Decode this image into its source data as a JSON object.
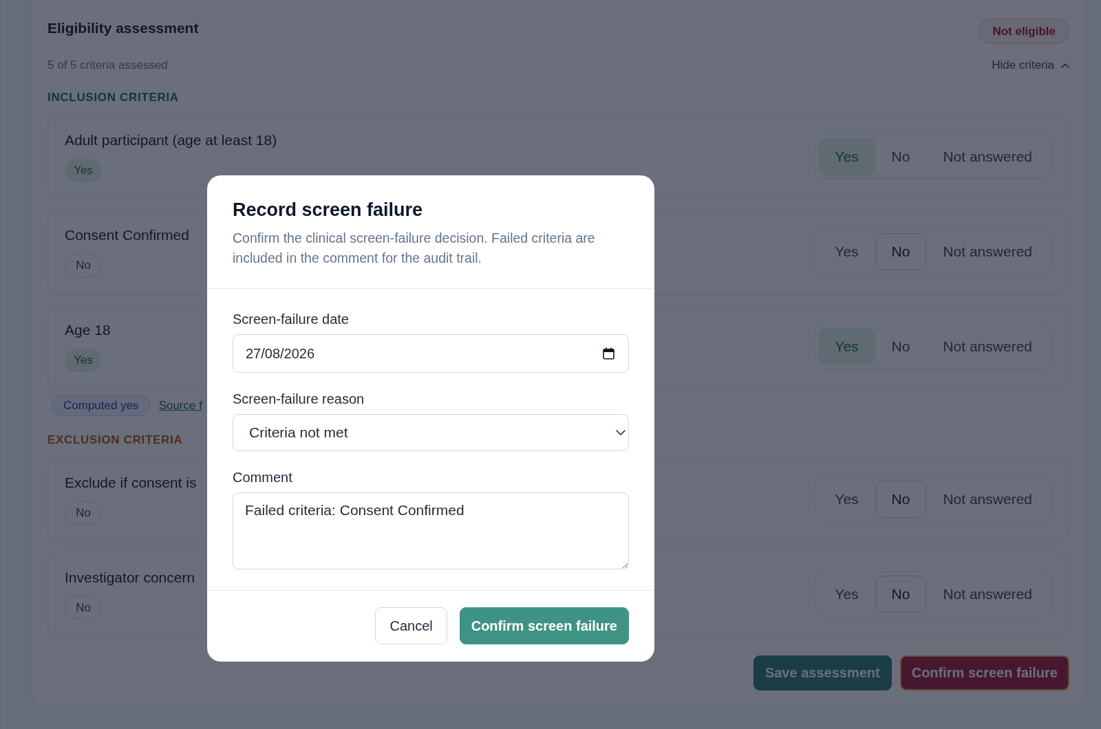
{
  "assessment": {
    "title": "Eligibility assessment",
    "status_badge": "Not eligible",
    "progress": "5 of 5 criteria assessed",
    "toggle": {
      "label": "Hide criteria",
      "expanded": true
    }
  },
  "sections": [
    {
      "heading": "INCLUSION CRITERIA",
      "kind": "inclusion",
      "criteria": [
        {
          "title": "Adult participant (age at least 18)",
          "answer": {
            "label": "Yes",
            "kind": "yes"
          },
          "options": [
            {
              "label": "Yes",
              "kind": "yes",
              "selected": true
            },
            {
              "label": "No",
              "kind": "no",
              "selected": false
            },
            {
              "label": "Not answered",
              "kind": "unanswered",
              "selected": false
            }
          ]
        },
        {
          "title": "Consent Confirmed",
          "answer": {
            "label": "No",
            "kind": "no"
          },
          "options": [
            {
              "label": "Yes",
              "kind": "yes",
              "selected": false
            },
            {
              "label": "No",
              "kind": "no",
              "selected": true
            },
            {
              "label": "Not answered",
              "kind": "unanswered",
              "selected": false
            }
          ]
        },
        {
          "title": "Age 18",
          "answer": {
            "label": "Yes",
            "kind": "yes"
          },
          "options": [
            {
              "label": "Yes",
              "kind": "yes",
              "selected": true
            },
            {
              "label": "No",
              "kind": "no",
              "selected": false
            },
            {
              "label": "Not answered",
              "kind": "unanswered",
              "selected": false
            }
          ],
          "computed": {
            "badge": "Computed yes",
            "link": "Source f"
          }
        }
      ]
    },
    {
      "heading": "EXCLUSION CRITERIA",
      "kind": "exclusion",
      "criteria": [
        {
          "title": "Exclude if consent is",
          "answer": {
            "label": "No",
            "kind": "no"
          },
          "options": [
            {
              "label": "Yes",
              "kind": "yes",
              "selected": false
            },
            {
              "label": "No",
              "kind": "no",
              "selected": true
            },
            {
              "label": "Not answered",
              "kind": "unanswered",
              "selected": false
            }
          ]
        },
        {
          "title": "Investigator concern",
          "answer": {
            "label": "No",
            "kind": "no"
          },
          "options": [
            {
              "label": "Yes",
              "kind": "yes",
              "selected": false
            },
            {
              "label": "No",
              "kind": "no",
              "selected": true
            },
            {
              "label": "Not answered",
              "kind": "unanswered",
              "selected": false
            }
          ]
        }
      ]
    }
  ],
  "actions": [
    {
      "label": "Save assessment",
      "kind": "save",
      "focused": false
    },
    {
      "label": "Confirm screen failure",
      "kind": "danger",
      "focused": true
    }
  ],
  "dialog": {
    "title": "Record screen failure",
    "description": "Confirm the clinical screen-failure decision. Failed criteria are included in the comment for the audit trail.",
    "fields": [
      {
        "kind": "date",
        "label": "Screen-failure date",
        "value": "27/08/2026"
      },
      {
        "kind": "select",
        "label": "Screen-failure reason",
        "value": "Criteria not met"
      },
      {
        "kind": "textarea",
        "label": "Comment",
        "value": "Failed criteria: Consent Confirmed"
      }
    ],
    "buttons": [
      {
        "label": "Cancel",
        "kind": "secondary"
      },
      {
        "label": "Confirm screen failure",
        "kind": "primary"
      }
    ]
  }
}
